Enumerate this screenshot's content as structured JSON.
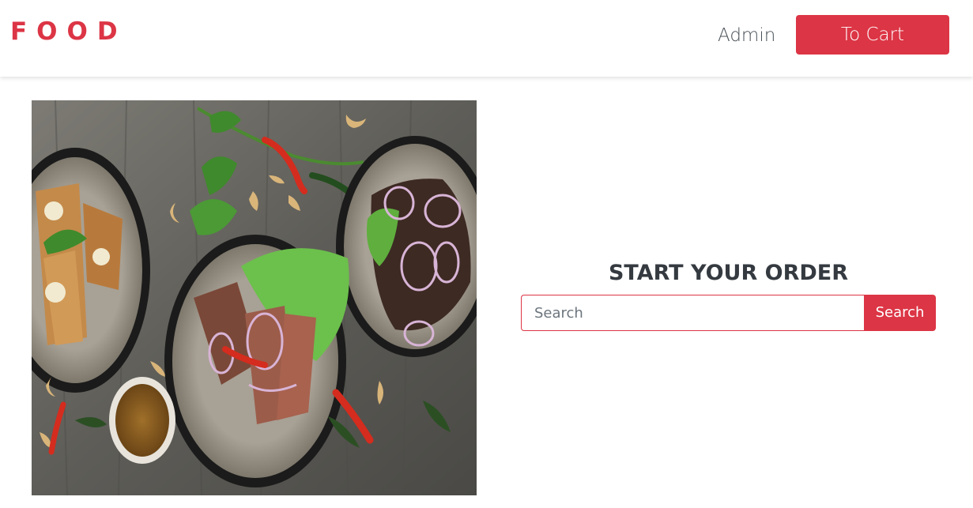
{
  "navbar": {
    "brand": "FOOD",
    "admin_link": "Admin",
    "cart_button": "To Cart"
  },
  "hero": {
    "title": "START YOUR ORDER",
    "search_placeholder": "Search",
    "search_button": "Search"
  },
  "colors": {
    "accent": "#dc3545",
    "text_dark": "#343a40",
    "wood": "#6b6b66"
  }
}
